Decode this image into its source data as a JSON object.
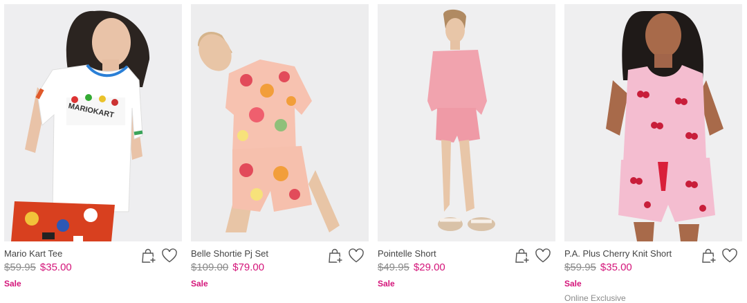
{
  "products": [
    {
      "name": "Mario Kart Tee",
      "was_price": "$59.95",
      "price": "$35.00",
      "badge": "Sale",
      "extra": "",
      "image_alt": "Model wearing white Mario Kart tee with red printed pyjama pants"
    },
    {
      "name": "Belle Shortie Pj Set",
      "was_price": "$109.00",
      "price": "$79.00",
      "badge": "Sale",
      "extra": "",
      "image_alt": "Model wearing floral Belle shortie pyjama set"
    },
    {
      "name": "Pointelle Short",
      "was_price": "$49.95",
      "price": "$29.00",
      "badge": "Sale",
      "extra": "",
      "image_alt": "Model wearing pink pointelle top and shorts with slippers"
    },
    {
      "name": "P.A. Plus Cherry Knit Short",
      "was_price": "$59.95",
      "price": "$35.00",
      "badge": "Sale",
      "extra": "Online Exclusive",
      "image_alt": "Model wearing pink cherry knit singlet and shorts"
    }
  ],
  "icons": {
    "add_to_bag": "add-to-bag-icon",
    "wishlist": "heart-icon"
  },
  "colors": {
    "sale_pink": "#d4157a",
    "strike_grey": "#8a8a8a",
    "image_bg": "#f0f0f1"
  }
}
